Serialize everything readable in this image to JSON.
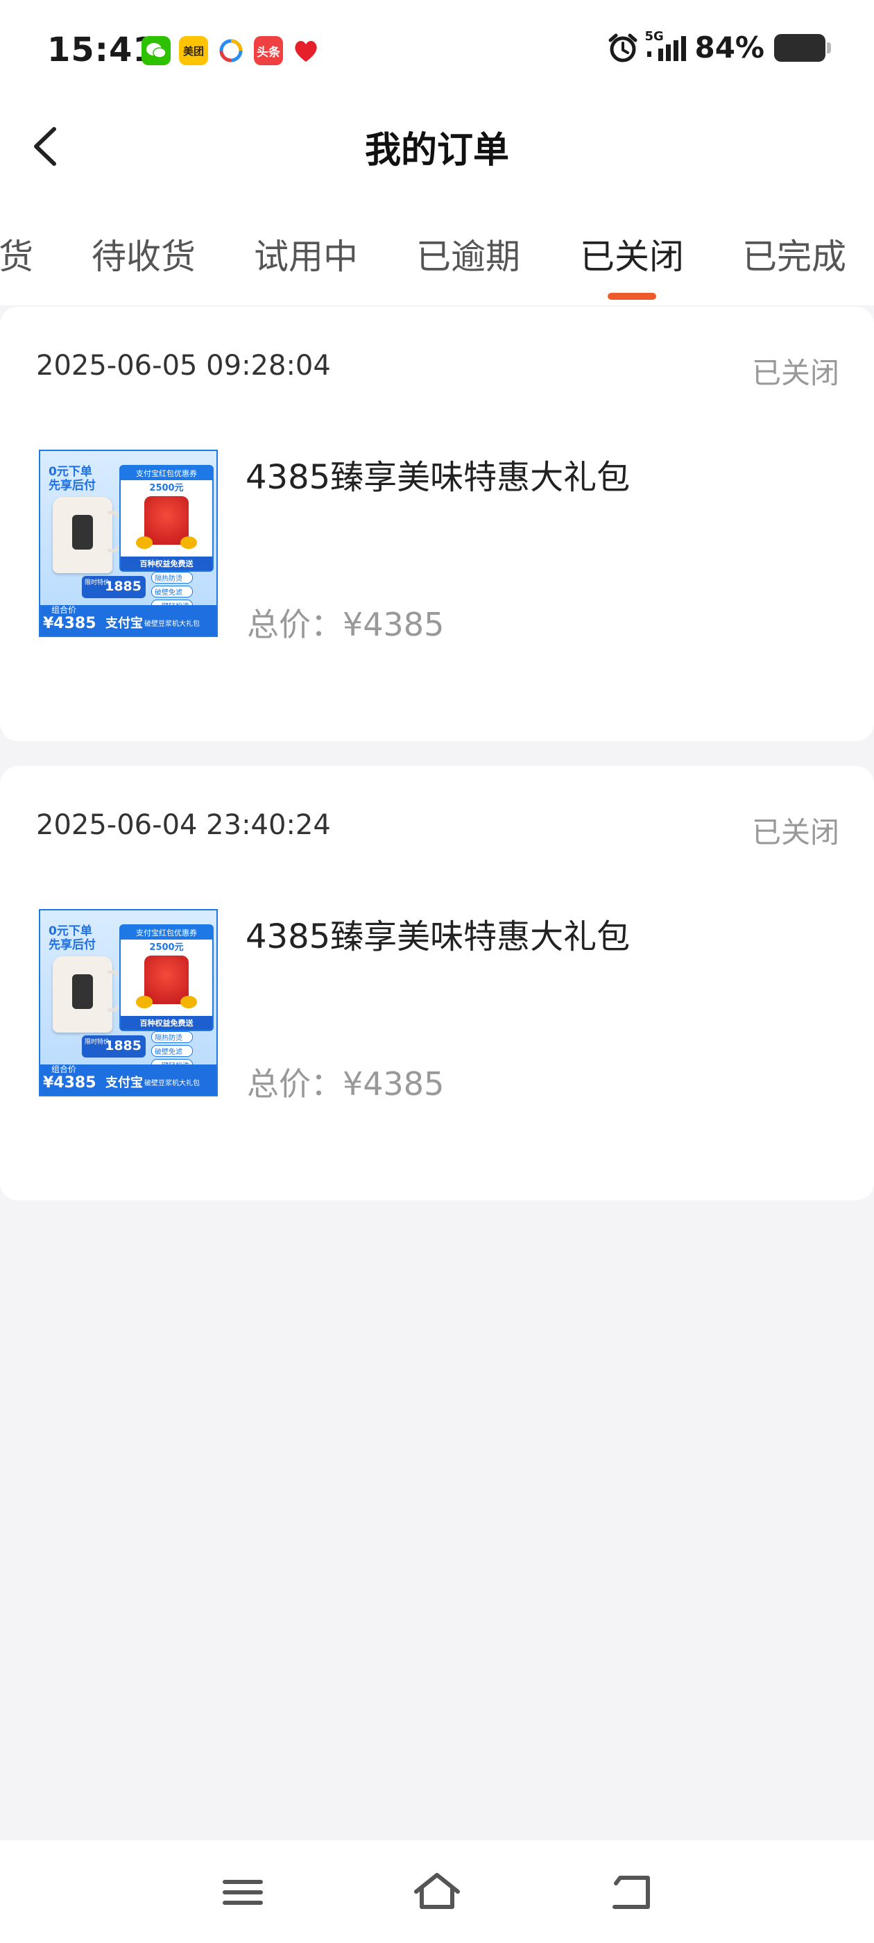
{
  "status_bar": {
    "time": "15:41",
    "apps": [
      {
        "name": "wechat-icon",
        "label": "",
        "color": "#2dc100"
      },
      {
        "name": "meituan-icon",
        "label": "美团",
        "color": "#ffc300"
      },
      {
        "name": "tencent-video-icon",
        "label": "",
        "color": "#ffffff"
      },
      {
        "name": "toutiao-icon",
        "label": "头条",
        "color": "#f04142"
      },
      {
        "name": "heart-app-icon",
        "label": "",
        "color": "#e6202a"
      }
    ],
    "network": "5G",
    "battery_percent": "84%"
  },
  "header": {
    "title": "我的订单"
  },
  "tabs": {
    "items": [
      {
        "label": "货"
      },
      {
        "label": "待收货"
      },
      {
        "label": "试用中"
      },
      {
        "label": "已逾期"
      },
      {
        "label": "已关闭"
      },
      {
        "label": "已完成"
      }
    ],
    "active_index": 4,
    "accent_color": "#f05a2a"
  },
  "orders": [
    {
      "datetime": "2025-06-05 09:28:04",
      "status": "已关闭",
      "product_name": "4385臻享美味特惠大礼包",
      "price_text": "总价：¥4385",
      "thumb": {
        "badge_top": "0元下单",
        "badge_sub": "先享后付",
        "benefit_title": "支付宝红包优惠券",
        "benefit_value": "2500元",
        "benefit_banner": "百种权益免费送",
        "perks": [
          "隔热防烫",
          "破壁免滤",
          "一键轻松洗"
        ],
        "price_label": "限时特价",
        "price_small": "1885",
        "combo_label": "组合价",
        "combo_price": "¥4385",
        "footer": "支付宝",
        "footer_sub": "破壁豆浆机大礼包"
      }
    },
    {
      "datetime": "2025-06-04 23:40:24",
      "status": "已关闭",
      "product_name": "4385臻享美味特惠大礼包",
      "price_text": "总价：¥4385",
      "thumb": {
        "badge_top": "0元下单",
        "badge_sub": "先享后付",
        "benefit_title": "支付宝红包优惠券",
        "benefit_value": "2500元",
        "benefit_banner": "百种权益免费送",
        "perks": [
          "隔热防烫",
          "破壁免滤",
          "一键轻松洗"
        ],
        "price_label": "限时特价",
        "price_small": "1885",
        "combo_label": "组合价",
        "combo_price": "¥4385",
        "footer": "支付宝",
        "footer_sub": "破壁豆浆机大礼包"
      }
    }
  ],
  "nav_bar": {
    "items": [
      {
        "name": "menu-icon"
      },
      {
        "name": "home-icon"
      },
      {
        "name": "back-icon"
      }
    ]
  }
}
